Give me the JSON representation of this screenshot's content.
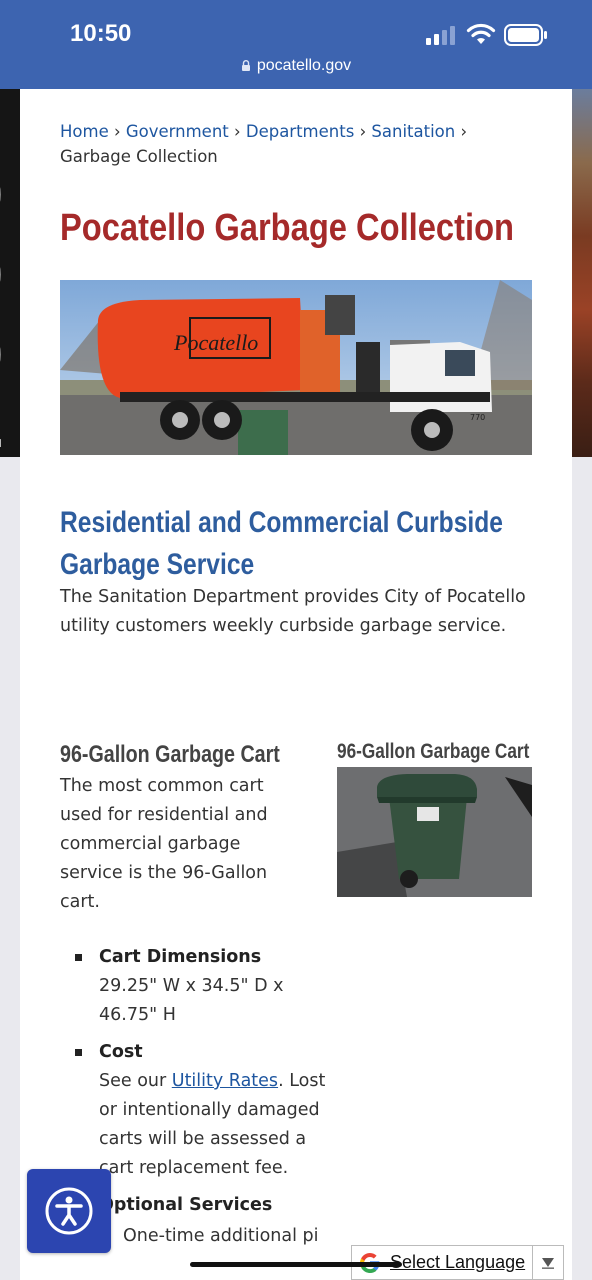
{
  "status_bar": {
    "time": "10:50",
    "url": "pocatello.gov"
  },
  "breadcrumb": {
    "links": [
      "Home",
      "Government",
      "Departments",
      "Sanitation"
    ],
    "separator": "›",
    "current": "Garbage Collection"
  },
  "page_title": "Pocatello Garbage Collection",
  "hero_truck": {
    "logo_text": "Pocatello",
    "unit_number": "770"
  },
  "section": {
    "heading": "Residential and Commercial Curbside Garbage Service",
    "intro": "The Sanitation Department provides City of Pocatello utility customers weekly curbside garbage service."
  },
  "cart": {
    "heading": "96-Gallon Garbage Cart",
    "text": "The most common cart used for residential and commercial garbage service is the 96-Gallon cart.",
    "figure_caption": "96-Gallon Garbage Cart"
  },
  "info": {
    "dimensions_term": "Cart Dimensions",
    "dimensions_value": "29.25\" W x 34.5\" D x 46.75\" H",
    "cost_term": "Cost",
    "cost_prefix": "See our ",
    "cost_link": "Utility Rates",
    "cost_suffix": ". Lost or intentionally damaged carts will be assessed a cart replacement fee.",
    "optional_term": "Optional Services",
    "optional_first": "One-time additional pi"
  },
  "language_widget": {
    "label": "Select Language"
  },
  "colors": {
    "status_bar": "#3d64b0",
    "title": "#a52a2a",
    "heading": "#2e5d9e",
    "link": "#1e56a0"
  }
}
